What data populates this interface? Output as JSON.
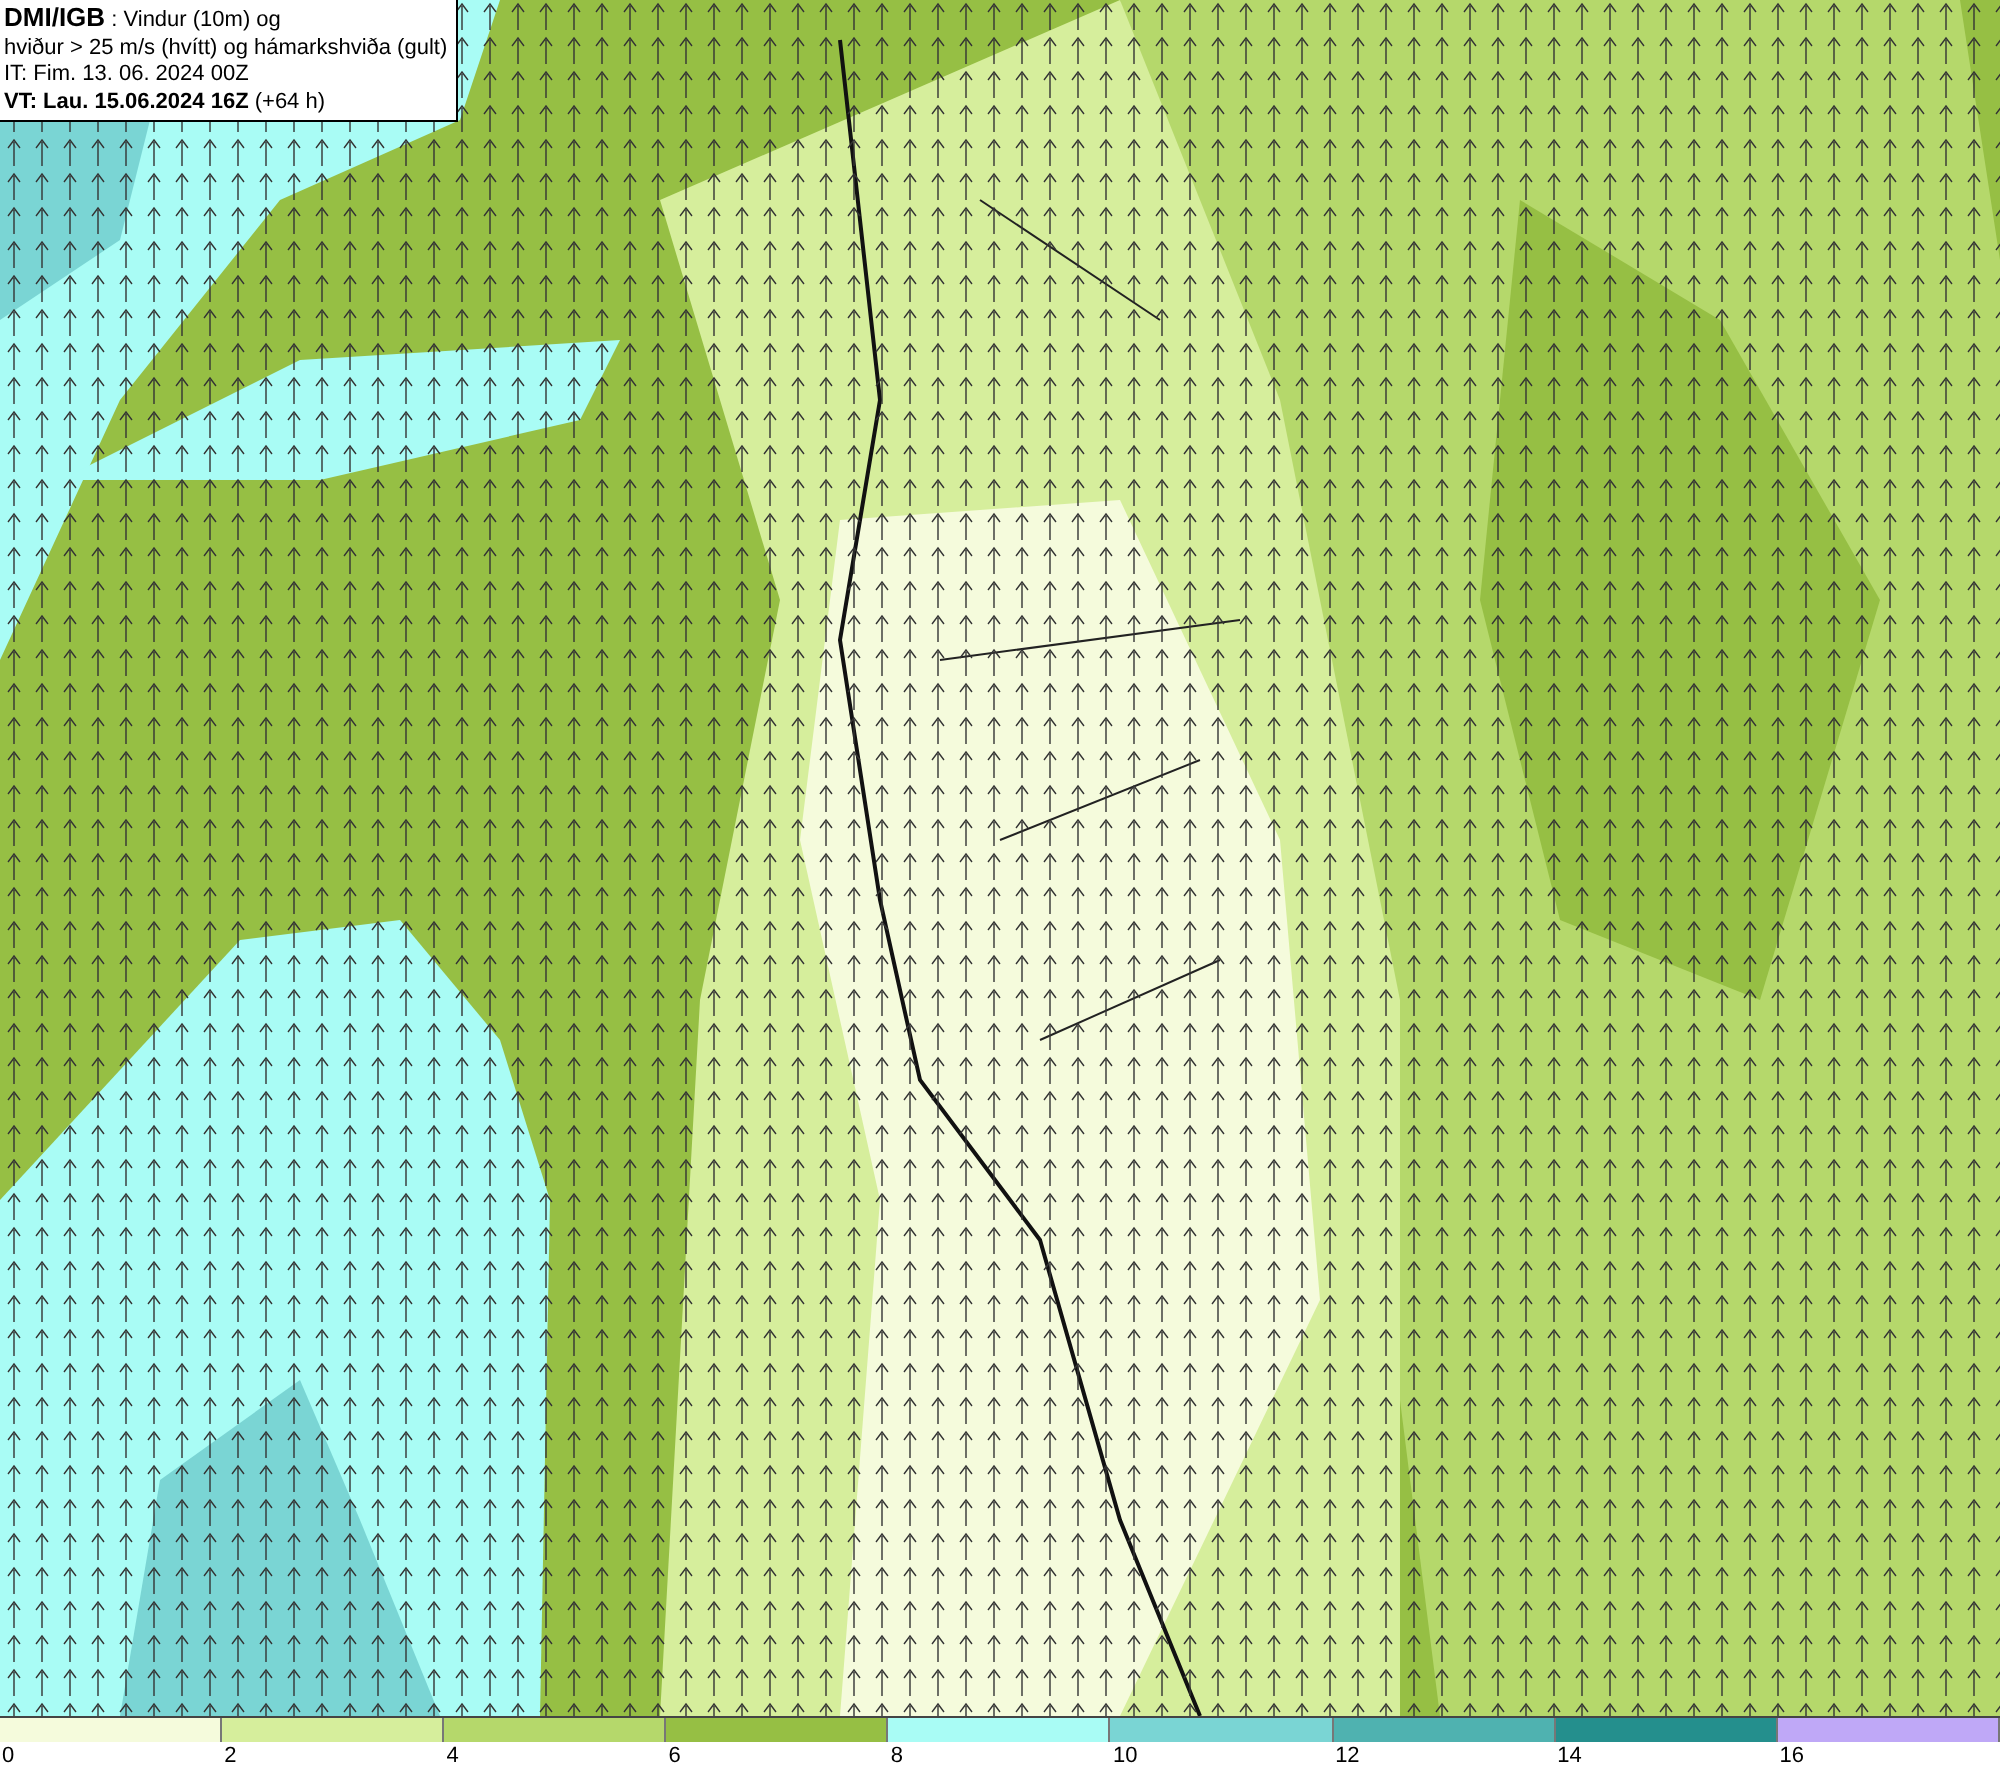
{
  "header": {
    "source": "DMI/IGB",
    "title": ": Vindur (10m) og",
    "subtitle": "hviður > 25 m/s (hvítt) og hámarkshviða (gult)",
    "initial_time": "IT: Fim. 13. 06. 2024 00Z",
    "valid_time": "**VT: Lau. 15.06.2024 16Z** (+64 h)"
  },
  "legend": [
    {
      "label": "0",
      "color": "#f5fbdc"
    },
    {
      "label": "2",
      "color": "#d6ee9c"
    },
    {
      "label": "4",
      "color": "#b5d86b"
    },
    {
      "label": "6",
      "color": "#96bf44"
    },
    {
      "label": "8",
      "color": "#a9fcf5"
    },
    {
      "label": "10",
      "color": "#7ad5d4"
    },
    {
      "label": "12",
      "color": "#4fb2b0"
    },
    {
      "label": "14",
      "color": "#248f8d"
    },
    {
      "label": "16",
      "color": "#bfa8f7"
    }
  ]
}
